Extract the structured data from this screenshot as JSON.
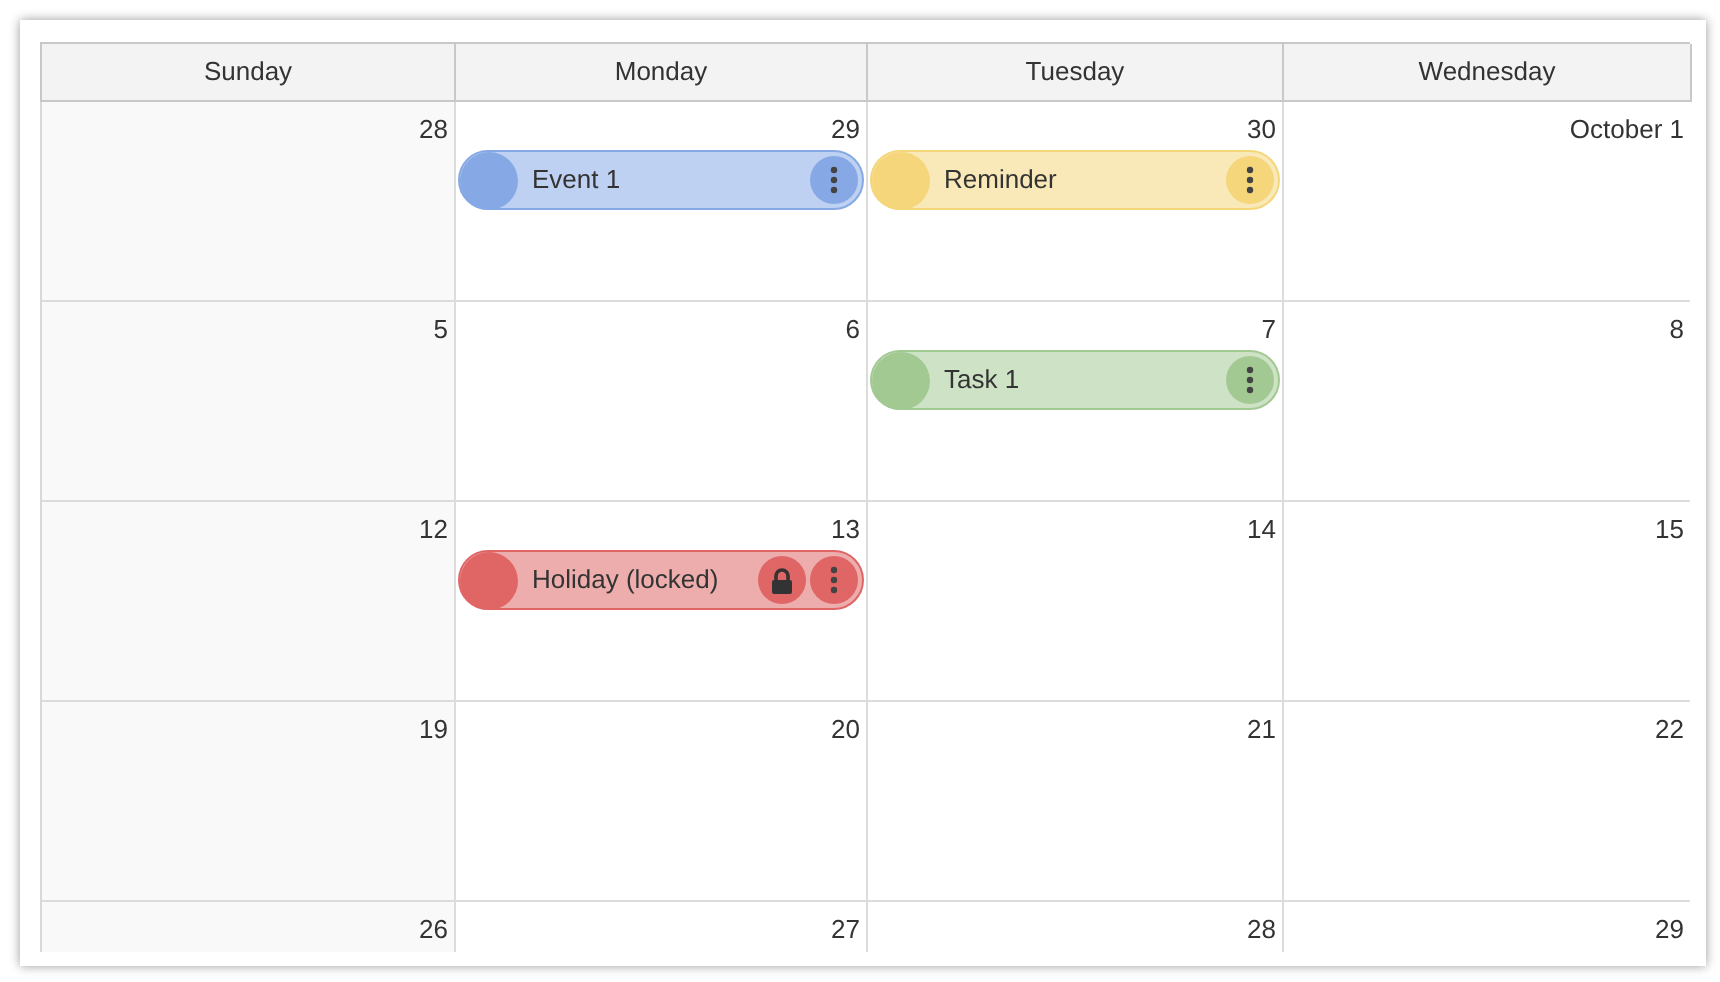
{
  "columns": [
    {
      "label": "Sunday",
      "color": "#f9f9f9"
    },
    {
      "label": "Monday",
      "color": "#ffffff"
    },
    {
      "label": "Tuesday",
      "color": "#ffffff"
    },
    {
      "label": "Wednesday",
      "color": "#ffffff"
    }
  ],
  "weeks": [
    {
      "days": [
        {
          "label": "28"
        },
        {
          "label": "29",
          "events": [
            {
              "text": "Event 1",
              "color": "#86a9e6",
              "locked": false
            }
          ]
        },
        {
          "label": "30",
          "events": [
            {
              "text": "Reminder",
              "color": "#f5d67a",
              "locked": false
            }
          ]
        },
        {
          "label": "October 1"
        }
      ]
    },
    {
      "days": [
        {
          "label": "5"
        },
        {
          "label": "6"
        },
        {
          "label": "7",
          "events": [
            {
              "text": "Task 1",
              "color": "#a3c993",
              "locked": false
            }
          ]
        },
        {
          "label": "8"
        }
      ]
    },
    {
      "days": [
        {
          "label": "12"
        },
        {
          "label": "13",
          "events": [
            {
              "text": "Holiday (locked)",
              "color": "#e06666",
              "locked": true
            }
          ]
        },
        {
          "label": "14"
        },
        {
          "label": "15"
        }
      ]
    },
    {
      "days": [
        {
          "label": "19"
        },
        {
          "label": "20"
        },
        {
          "label": "21"
        },
        {
          "label": "22"
        }
      ]
    },
    {
      "days": [
        {
          "label": "26"
        },
        {
          "label": "27"
        },
        {
          "label": "28"
        },
        {
          "label": "29"
        }
      ]
    }
  ]
}
